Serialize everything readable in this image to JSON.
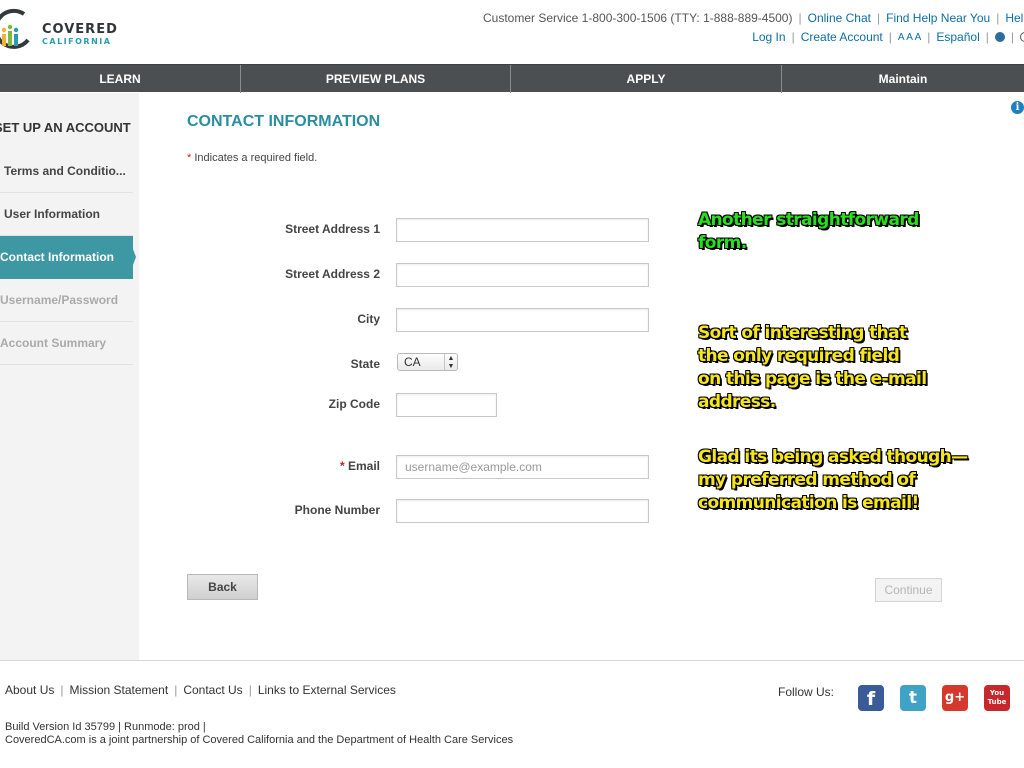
{
  "brand": {
    "line1": "COVERED",
    "line2": "CALIFORNIA",
    "accent": "#2b9bb1"
  },
  "utility": {
    "customer_service": "Customer Service 1-800-300-1506 (TTY: 1-888-889-4500)",
    "online_chat": "Online Chat",
    "find_help": "Find Help Near You",
    "help_cut": "Help",
    "log_in": "Log In",
    "create_account": "Create Account",
    "text_size": "A A A",
    "espanol": "Español",
    "language_icon": "globe-icon"
  },
  "nav": {
    "items": [
      "LEARN",
      "PREVIEW PLANS",
      "APPLY",
      "Maintain"
    ]
  },
  "sidebar": {
    "title": "SET UP AN ACCOUNT",
    "items": [
      {
        "label": "Terms and Conditio...",
        "state": "done"
      },
      {
        "label": "User Information",
        "state": "done"
      },
      {
        "label": "Contact Information",
        "state": "active"
      },
      {
        "label": "Username/Password",
        "state": "disabled"
      },
      {
        "label": "Account Summary",
        "state": "disabled"
      }
    ],
    "active_color": "#3d98a3"
  },
  "main": {
    "title": "CONTACT INFORMATION",
    "required_star": "*",
    "required_note": "Indicates a required field.",
    "fields": {
      "street1": {
        "label": "Street Address 1",
        "value": ""
      },
      "street2": {
        "label": "Street Address 2",
        "value": ""
      },
      "city": {
        "label": "City",
        "value": ""
      },
      "state": {
        "label": "State",
        "value": "CA"
      },
      "zip": {
        "label": "Zip Code",
        "value": ""
      },
      "email": {
        "label": "Email",
        "required": "*",
        "value": "",
        "placeholder": "username@example.com"
      },
      "phone": {
        "label": "Phone Number",
        "value": ""
      }
    },
    "back_label": "Back",
    "continue_label": "Continue"
  },
  "annotations": {
    "note1": "Another straightforward\nform.",
    "note2": "Sort of interesting that\nthe only required field\non this page is the e-mail\naddress.",
    "note3": "Glad its being asked though—\nmy preferred method of\ncommunication is email!"
  },
  "footer": {
    "links": [
      "About Us",
      "Mission Statement",
      "Contact Us",
      "Links to External Services"
    ],
    "follow_us": "Follow Us:",
    "social": {
      "facebook": "f",
      "twitter": "t",
      "googleplus": "g+",
      "youtube_line1": "You",
      "youtube_line2": "Tube"
    },
    "build": "Build Version Id 35799 |   Runmode: prod |",
    "partnership": "CoveredCA.com is a joint partnership of Covered California and the Department of Health Care Services"
  }
}
